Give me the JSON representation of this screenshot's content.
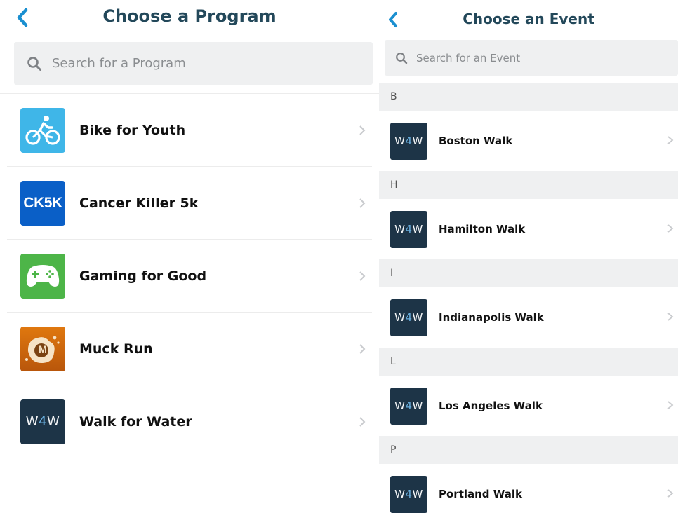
{
  "programs_screen": {
    "title": "Choose a Program",
    "search_placeholder": "Search for a Program",
    "items": [
      {
        "label": "Bike for Youth",
        "icon": "cyclist-icon",
        "icon_color": "#3fb6e8"
      },
      {
        "label": "Cancer Killer 5k",
        "icon_text": "CK5K",
        "icon_color": "#0a5fc7"
      },
      {
        "label": "Gaming for Good",
        "icon": "gamepad-icon",
        "icon_color": "#4db548"
      },
      {
        "label": "Muck Run",
        "icon_text": "M",
        "icon_color": "#d06a12"
      },
      {
        "label": "Walk for Water",
        "icon_text": "W4W",
        "icon_color": "#1d3447"
      }
    ]
  },
  "events_screen": {
    "title": "Choose an Event",
    "search_placeholder": "Search for an Event",
    "sections": [
      {
        "letter": "B",
        "events": [
          {
            "label": "Boston Walk",
            "icon_text": "W4W"
          }
        ]
      },
      {
        "letter": "H",
        "events": [
          {
            "label": "Hamilton Walk",
            "icon_text": "W4W"
          }
        ]
      },
      {
        "letter": "I",
        "events": [
          {
            "label": "Indianapolis Walk",
            "icon_text": "W4W"
          }
        ]
      },
      {
        "letter": "L",
        "events": [
          {
            "label": "Los Angeles Walk",
            "icon_text": "W4W"
          }
        ]
      },
      {
        "letter": "P",
        "events": [
          {
            "label": "Portland Walk",
            "icon_text": "W4W"
          }
        ]
      }
    ]
  },
  "colors": {
    "title": "#23485a",
    "back_arrow": "#1a8fd0",
    "search_bg": "#eff0f1",
    "section_bg": "#eff0f1",
    "w4w_tile": "#1d3447",
    "w4w_accent": "#6ab0e0"
  }
}
